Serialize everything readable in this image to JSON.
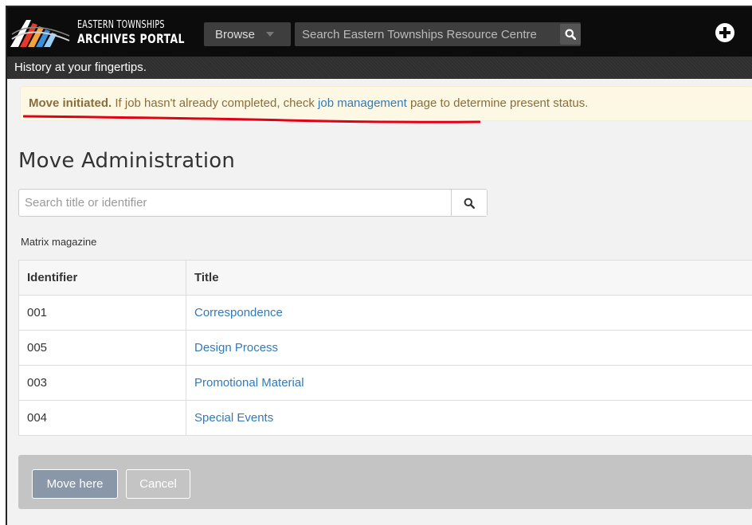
{
  "header": {
    "logo_line1": "EASTERN TOWNSHIPS",
    "logo_line2": "ARCHIVES PORTAL",
    "browse_label": "Browse",
    "search_placeholder": "Search Eastern Townships Resource Centre",
    "tagline": "History at your fingertips."
  },
  "alert": {
    "strong": "Move initiated.",
    "text_before_link": " If job hasn't already completed, check ",
    "link": "job management",
    "text_after_link": " page to determine present status."
  },
  "page": {
    "title": "Move Administration",
    "search_placeholder": "Search title or identifier",
    "breadcrumb": "Matrix magazine"
  },
  "table": {
    "headers": [
      "Identifier",
      "Title"
    ],
    "rows": [
      {
        "identifier": "001",
        "title": "Correspondence"
      },
      {
        "identifier": "005",
        "title": "Design Process"
      },
      {
        "identifier": "003",
        "title": "Promotional Material"
      },
      {
        "identifier": "004",
        "title": "Special Events"
      }
    ]
  },
  "actions": {
    "move_label": "Move here",
    "cancel_label": "Cancel"
  },
  "colors": {
    "header_bg": "#0c0c0c",
    "alert_bg": "#fcf8e3",
    "alert_text": "#8a6d3b",
    "link": "#337ab7",
    "annotation_underline": "#e0001a",
    "actions_bg": "#c4c4c4"
  },
  "icons": {
    "logo": "archives-portal-logo-icon",
    "header_search": "search-icon",
    "add": "plus-circle-icon",
    "admin_search": "search-icon",
    "browse_caret": "caret-down-icon"
  }
}
